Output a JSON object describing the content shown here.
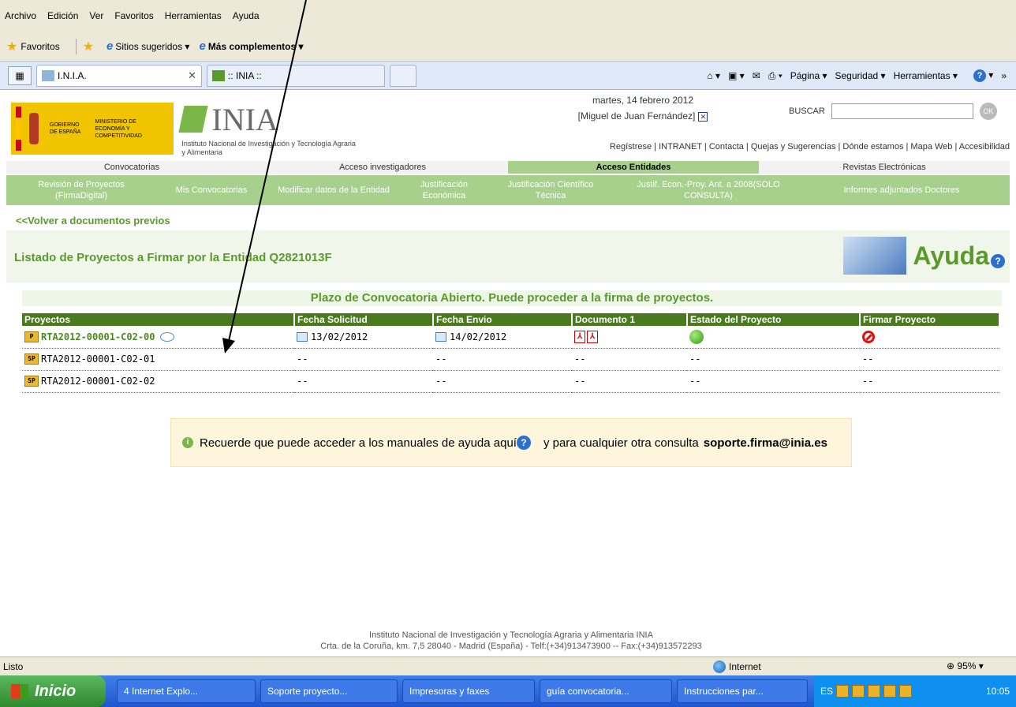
{
  "menu": [
    "Archivo",
    "Edición",
    "Ver",
    "Favoritos",
    "Herramientas",
    "Ayuda"
  ],
  "favorites": {
    "favoritos": "Favoritos",
    "sitios": "Sitios sugeridos ▾",
    "complementos": "Más complementos ▾"
  },
  "tabs": [
    {
      "title": "I.N.I.A."
    },
    {
      "title": ":: INIA ::"
    }
  ],
  "toolbar_right": [
    "Página ▾",
    "Seguridad ▾",
    "Herramientas ▾"
  ],
  "header": {
    "gov_lines": [
      "Gobierno de España",
      "Ministerio de Economía y Competitividad"
    ],
    "inia_word": "INIA",
    "inia_sub": "Instituto Nacional de Investigación y Tecnología Agraria y Alimentaria",
    "date": "martes, 14 febrero 2012",
    "user": "[Miguel de Juan Fernández]",
    "search_label": "BUSCAR",
    "ok_label": "OK",
    "links": "Regístrese | INTRANET | Contacta | Quejas y Sugerencias | Dónde estamos | Mapa Web | Accesibilidad"
  },
  "nav": [
    "Convocatorias",
    "Acceso investigadores",
    "Acceso Entidades",
    "Revistas Electrónicas"
  ],
  "subnav": [
    "Revisión de Proyectos (FirmaDigital)",
    "Mis Convocatorias",
    "Modificar datos de la Entidad",
    "Justificación Económica",
    "Justificación Científico Técnica",
    "Justif. Econ.-Proy. Ant. a 2008(SOLO CONSULTA)",
    "Informes adjuntados Doctores"
  ],
  "back_link": "<<Volver a documentos previos",
  "page_title": "Listado de Proyectos a Firmar por la Entidad Q2821013F",
  "ayuda": "Ayuda",
  "plazo": "Plazo de Convocatoria Abierto. Puede proceder a la firma de proyectos.",
  "table": {
    "headers": [
      "Proyectos",
      "Fecha Solicitud",
      "Fecha Envio",
      "Documento 1",
      "Estado del Proyecto",
      "Firmar Proyecto"
    ],
    "rows": [
      {
        "code": "RTA2012-00001-C02-00",
        "fecha_solicitud": "13/02/2012",
        "fecha_envio": "14/02/2012"
      },
      {
        "code": "RTA2012-00001-C02-01",
        "fecha_solicitud": "--",
        "fecha_envio": "--",
        "doc": "--",
        "estado": "--",
        "firmar": "--"
      },
      {
        "code": "RTA2012-00001-C02-02",
        "fecha_solicitud": "--",
        "fecha_envio": "--",
        "doc": "--",
        "estado": "--",
        "firmar": "--"
      }
    ]
  },
  "notice": {
    "text1": "Recuerde que puede acceder a los manuales de ayuda aquí",
    "text2": "y para cualquier otra consulta",
    "email": "soporte.firma@inia.es"
  },
  "footer": {
    "line1": "Instituto Nacional de Investigación y Tecnología Agraria y Alimentaria INIA",
    "line2": "Crta. de la Coruña, km. 7,5 28040 - Madrid (España) - Telf:(+34)913473900 -- Fax:(+34)913572293"
  },
  "status": {
    "listo": "Listo",
    "zone": "Internet",
    "zoom": "95%"
  },
  "taskbar": {
    "start": "Inicio",
    "tasks": [
      "4 Internet Explo...",
      "Soporte proyecto...",
      "Impresoras y faxes",
      "guía convocatoria...",
      "Instrucciones par..."
    ],
    "lang": "ES",
    "clock": "10:05"
  }
}
